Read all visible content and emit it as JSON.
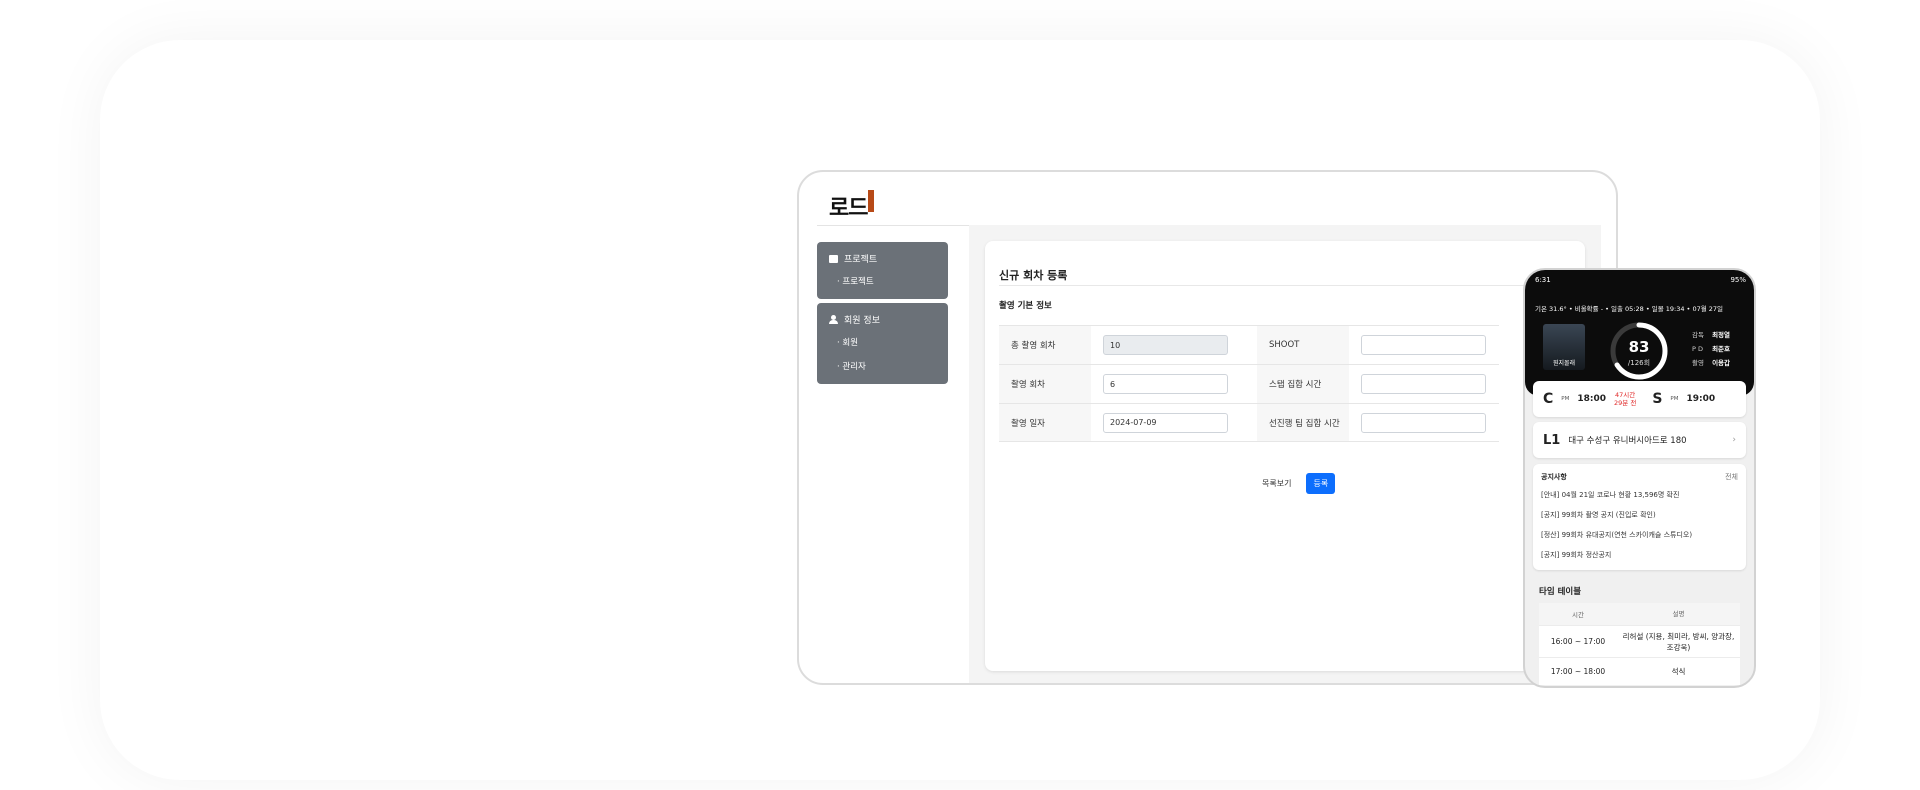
{
  "admin": {
    "logo_text": "로드",
    "sidebar": {
      "group1": {
        "title": "프로젝트",
        "items": [
          "프로젝트"
        ]
      },
      "group2": {
        "title": "회원 정보",
        "items": [
          "회원",
          "관리자"
        ]
      }
    },
    "form": {
      "title": "신규 회차 등록",
      "section": "촬영 기본 정보",
      "rows": [
        {
          "label_left": "총 촬영 회차",
          "value_left": "10",
          "label_right": "SHOOT",
          "value_right": ""
        },
        {
          "label_left": "촬영 회차",
          "value_left": "6",
          "label_right": "스탭 집합 시간",
          "value_right": ""
        },
        {
          "label_left": "촬영 일자",
          "value_left": "2024-07-09",
          "label_right": "선진행 팀 집합 시간",
          "value_right": ""
        }
      ],
      "list_button": "목록보기",
      "submit_button": "등록"
    }
  },
  "mobile": {
    "status_time": "6:31",
    "status_right": "95%",
    "weather": "기온 31.6° • 비올확률 - • 일출 05:28 • 일몰 19:34 • 07월 27일",
    "poster_title": "뭔지몰래",
    "count": "83",
    "total": "/126회",
    "progress": 0.6587,
    "crew": [
      {
        "role": "감독",
        "name": "최정열"
      },
      {
        "role": "P D",
        "name": "최준호"
      },
      {
        "role": "촬영",
        "name": "이용갑"
      }
    ],
    "call": {
      "letter": "C",
      "ampm": "PM",
      "time": "18:00"
    },
    "remaining": {
      "line1": "47시간",
      "line2": "29분 전"
    },
    "shoot": {
      "letter": "S",
      "ampm": "PM",
      "time": "19:00"
    },
    "location": {
      "code": "L1",
      "address": "대구 수성구 유니버시아드로 180"
    },
    "notice": {
      "title": "공지사항",
      "all": "전체",
      "items": [
        "[안내] 04월 21일 코로나 현황 13,596명 확진",
        "[공지] 99회차 촬영 공지 (진입로 확인)",
        "[정산] 99회차 유대공지(연천 스카이캐슬 스튜디오)",
        "[공지] 99회차 정산공지"
      ]
    },
    "timetable": {
      "title": "타임 테이블",
      "head_time": "시간",
      "head_desc": "설명",
      "rows": [
        {
          "time": "16:00 ~ 17:00",
          "desc": "리허설 (지용, 최미라, 방씨, 양과장, 조강욱)"
        },
        {
          "time": "17:00 ~ 18:00",
          "desc": "석식"
        }
      ]
    }
  },
  "colors": {
    "sidebar_bg": "#6b7178",
    "primary": "#0d6efd",
    "logo_accent": "#b84a17",
    "alert": "#e02828"
  }
}
